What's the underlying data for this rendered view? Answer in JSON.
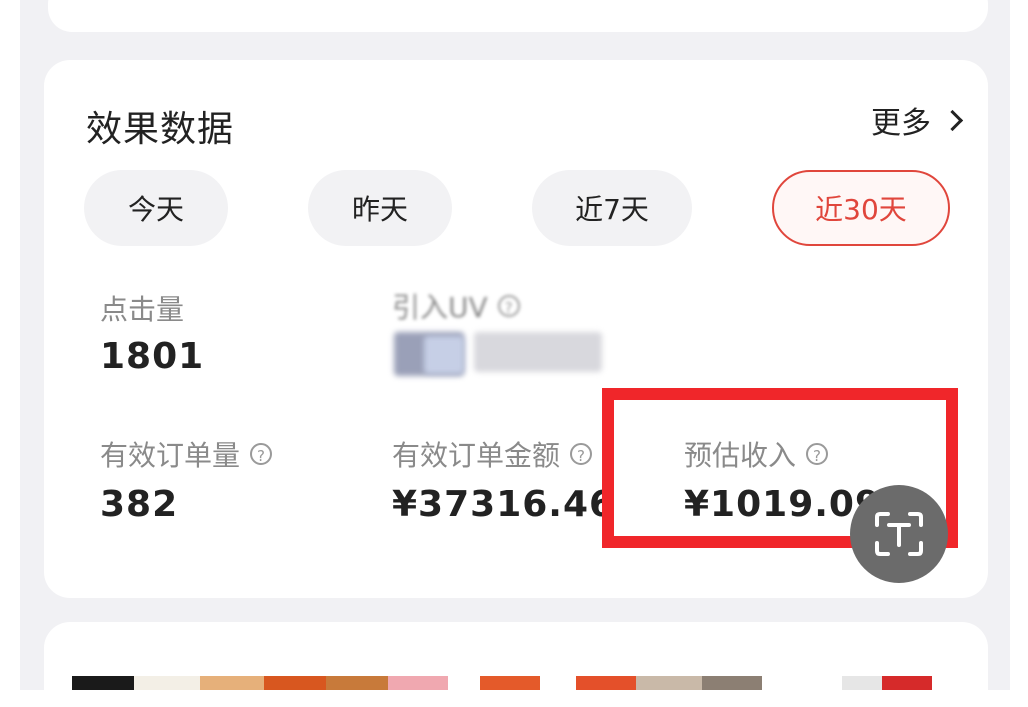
{
  "section": {
    "title": "效果数据",
    "more_label": "更多"
  },
  "tabs": [
    {
      "label": "今天",
      "active": false
    },
    {
      "label": "昨天",
      "active": false
    },
    {
      "label": "近7天",
      "active": false
    },
    {
      "label": "近30天",
      "active": true
    }
  ],
  "metrics": {
    "clicks": {
      "label": "点击量",
      "value": "1801"
    },
    "uv": {
      "label": "引入UV"
    },
    "valid_orders": {
      "label": "有效订单量",
      "value": "382"
    },
    "order_amount": {
      "label": "有效订单金额",
      "value": "¥37316.46"
    },
    "est_income": {
      "label": "预估收入",
      "value": "¥1019.09"
    }
  },
  "colors": {
    "accent": "#e0463c",
    "highlight_box": "#f0262a"
  },
  "icons": {
    "help": "question-circle-icon",
    "ocr": "text-scan-icon",
    "more": "chevron-right-icon"
  }
}
